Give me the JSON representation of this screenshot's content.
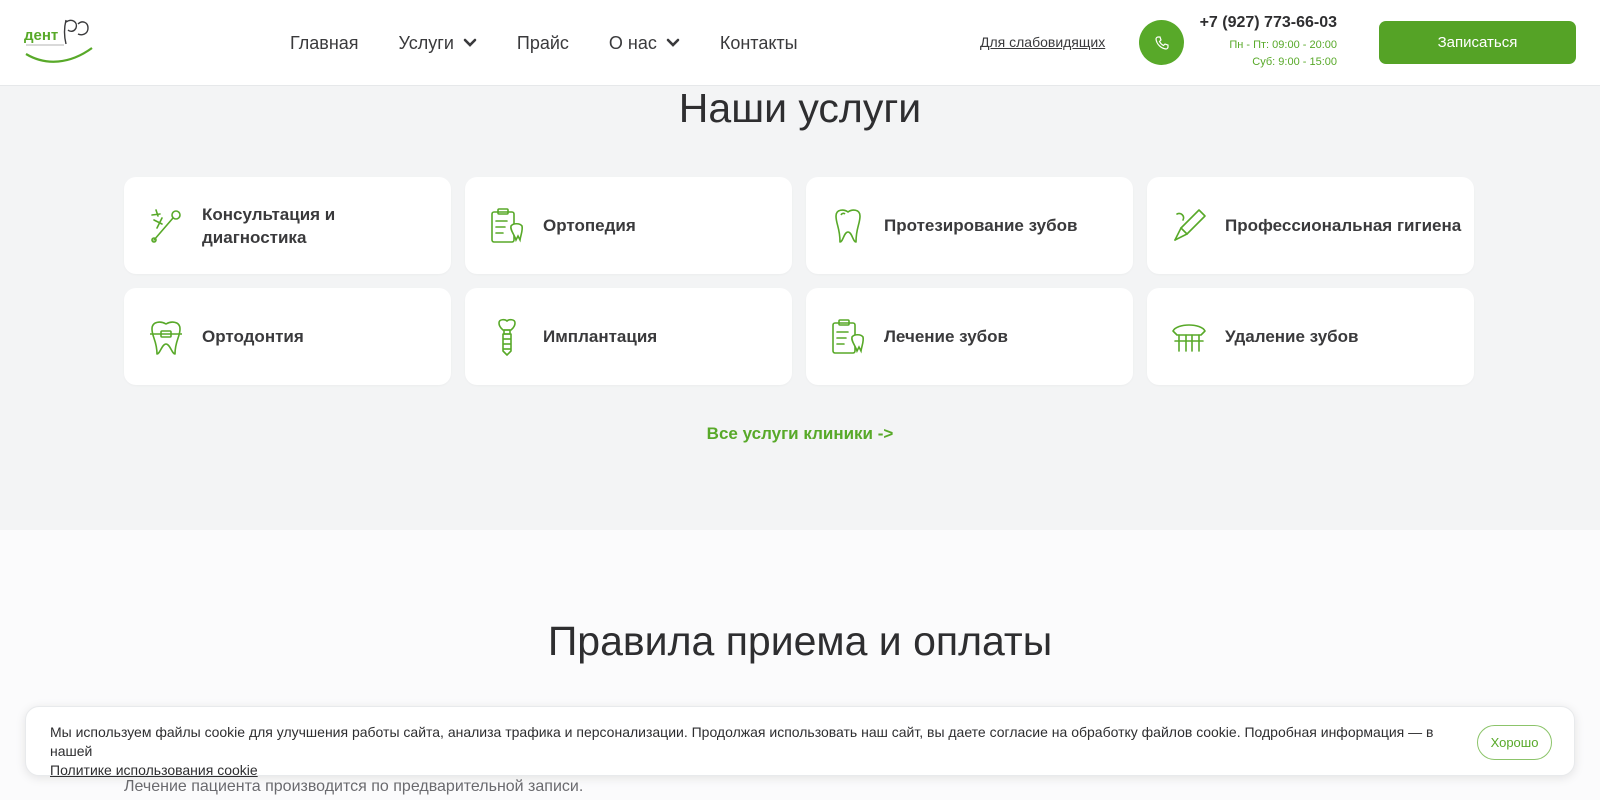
{
  "header": {
    "nav": [
      {
        "label": "Главная"
      },
      {
        "label": "Услуги"
      },
      {
        "label": "Прайс"
      },
      {
        "label": "О нас"
      },
      {
        "label": "Контакты"
      }
    ],
    "accessibility_link": "Для слабовидящих",
    "phone": "+7 (927) 773-66-03",
    "hours_weekdays": "Пн - Пт: 09:00 - 20:00",
    "hours_saturday": "Суб: 9:00 - 15:00",
    "signup_label": "Записаться"
  },
  "services": {
    "title": "Наши услуги",
    "items": [
      {
        "label": "Консультация и диагностика",
        "icon": "dental-mirror-icon"
      },
      {
        "label": "Ортопедия",
        "icon": "clipboard-tooth-icon"
      },
      {
        "label": "Протезирование зубов",
        "icon": "tooth-icon"
      },
      {
        "label": "Профессиональная гигиена",
        "icon": "dental-tool-icon"
      },
      {
        "label": "Ортодонтия",
        "icon": "tooth-braces-icon"
      },
      {
        "label": "Имплантация",
        "icon": "implant-icon"
      },
      {
        "label": "Лечение зубов",
        "icon": "clipboard-tooth-icon"
      },
      {
        "label": "Удаление зубов",
        "icon": "denture-icon"
      }
    ],
    "all_link": "Все услуги клиники ->"
  },
  "rules": {
    "title": "Правила приема и оплаты",
    "text": "Лечение пациента производится по предварительной записи."
  },
  "cookie": {
    "text": "Мы используем файлы cookie для улучшения работы сайта, анализа трафика и персонализации. Продолжая использовать наш сайт, вы даете согласие на обработку файлов cookie. Подробная информация — в нашей",
    "link": "Политике использования cookie",
    "ok_label": "Хорошо"
  },
  "colors": {
    "accent": "#58a929",
    "button": "#55a326",
    "text": "#2e2e30",
    "background": "#f3f4f5"
  }
}
